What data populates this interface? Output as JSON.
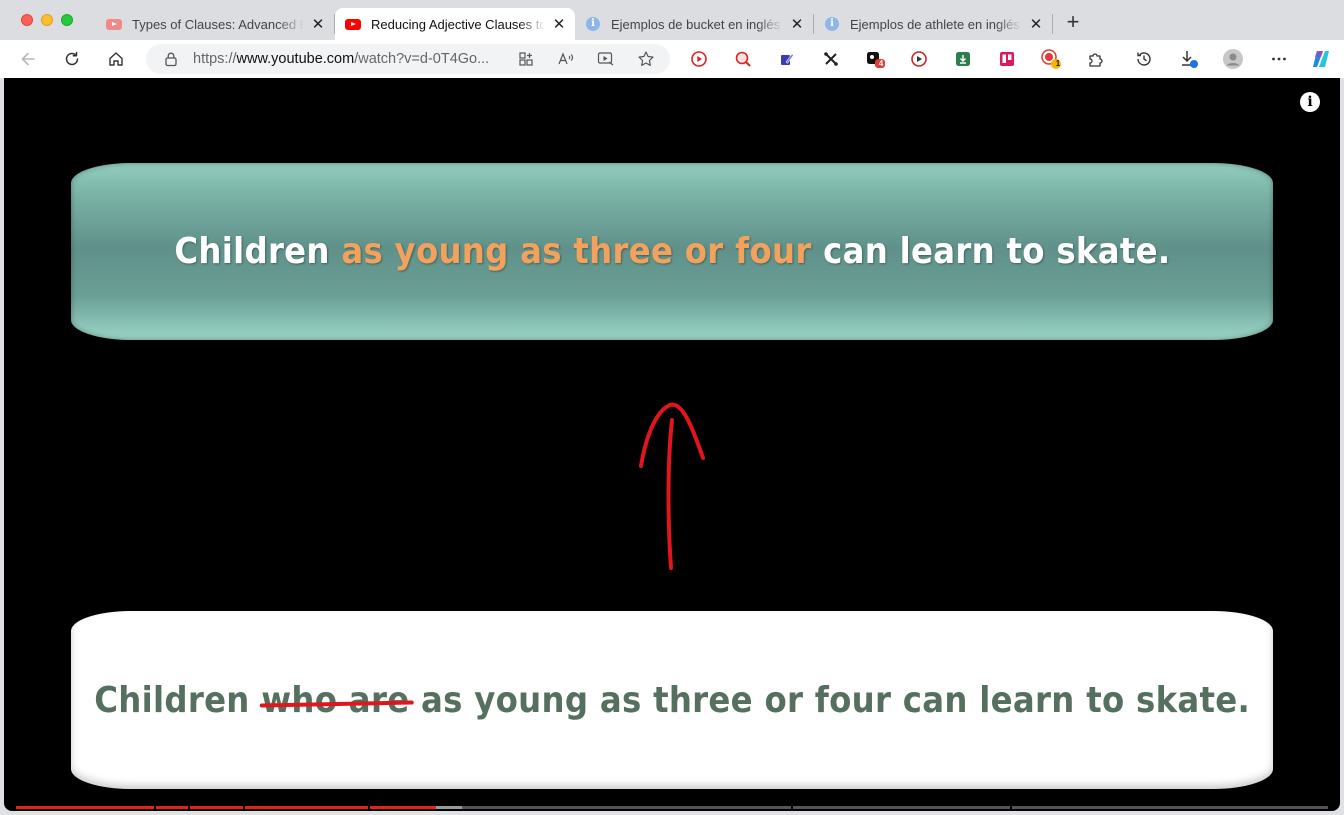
{
  "browser": {
    "tabs": [
      {
        "title": "Types of Clauses: Advanced English Grammar",
        "favicon": "youtube-icon",
        "active": false
      },
      {
        "title": "Reducing Adjective Clauses to Adjective Phrases",
        "favicon": "youtube-icon",
        "active": true
      },
      {
        "title": "Ejemplos de bucket en inglés",
        "favicon": "info-icon",
        "active": false
      },
      {
        "title": "Ejemplos de athlete en inglés",
        "favicon": "info-icon",
        "active": false
      }
    ],
    "url": {
      "scheme": "https://",
      "host": "www.youtube.com",
      "path": "/watch?v=d-0T4Go..."
    },
    "toolbar_icons": [
      "back-icon",
      "reload-icon",
      "home-icon",
      "lock-icon",
      "apps-icon",
      "read-aloud-icon",
      "immersive-reader-icon",
      "favorite-star-icon",
      "youtube-extension-icon",
      "search-extension-icon",
      "edit-extension-icon",
      "shortcut-extension-icon",
      "badge-extension-icon",
      "recorder-extension-icon",
      "download-extension-icon",
      "trello-icon",
      "record-extension-icon",
      "extensions-icon",
      "history-icon",
      "downloads-icon",
      "profile-icon",
      "more-menu-icon",
      "copilot-icon"
    ],
    "badges": {
      "badge_extension": "4",
      "record_extension": "1"
    }
  },
  "video": {
    "top_sentence": {
      "before": "Children ",
      "highlight": "as young as three or four",
      "after": " can learn to skate."
    },
    "bottom_sentence": {
      "before": "Children ",
      "struck": "who are",
      "after": " as young as three or four can learn to skate."
    },
    "colors": {
      "highlight": "#f3a25e",
      "strike": "#e0161c",
      "bottom_text": "#55705f",
      "progress": "#e62117"
    }
  }
}
